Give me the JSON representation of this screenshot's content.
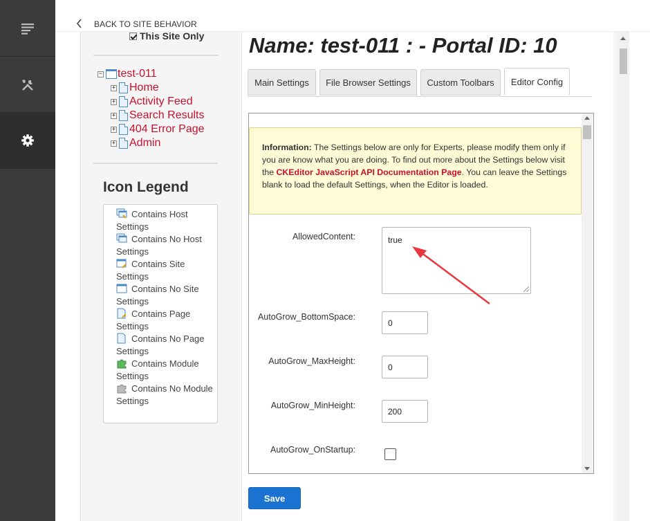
{
  "nav": {
    "back_label": "BACK TO SITE BEHAVIOR",
    "rail_icons": [
      "content-icon",
      "tools-icon",
      "settings-icon"
    ]
  },
  "tree": {
    "this_site_only_label": "This Site Only",
    "this_site_only_checked": true,
    "root": "test-011",
    "pages": [
      "Home",
      "Activity Feed",
      "Search Results",
      "404 Error Page",
      "Admin"
    ]
  },
  "legend": {
    "title": "Icon Legend",
    "items": [
      {
        "label": "Contains Host Settings",
        "icon": "host-settings-icon"
      },
      {
        "label": "Contains No Host Settings",
        "icon": "no-host-settings-icon"
      },
      {
        "label": "Contains Site Settings",
        "icon": "site-settings-icon"
      },
      {
        "label": "Contains No Site Settings",
        "icon": "no-site-settings-icon"
      },
      {
        "label": "Contains Page Settings",
        "icon": "page-settings-icon"
      },
      {
        "label": "Contains No Page Settings",
        "icon": "no-page-settings-icon"
      },
      {
        "label": "Contains Module Settings",
        "icon": "module-settings-icon"
      },
      {
        "label": "Contains No Module Settings",
        "icon": "no-module-settings-icon"
      }
    ]
  },
  "main": {
    "heading": "Name: test-011 : - Portal ID: 10",
    "tabs": [
      {
        "label": "Main Settings",
        "active": false
      },
      {
        "label": "File Browser Settings",
        "active": false
      },
      {
        "label": "Custom Toolbars",
        "active": false
      },
      {
        "label": "Editor Config",
        "active": true
      }
    ],
    "info": {
      "lead": "Information:",
      "text1": " The Settings below are only for Experts, please modify them only if you are know what you are doing. To find out more about the Settings below visit the ",
      "link": "CKEditor JavaScript API Documentation Page",
      "text2": ". You can leave the Settings blank to load the default Settings, when the Editor is loaded."
    },
    "fields": {
      "allowed_content": {
        "label": "AllowedContent:",
        "value": "true"
      },
      "bottom_space": {
        "label": "AutoGrow_BottomSpace:",
        "value": "0"
      },
      "max_height": {
        "label": "AutoGrow_MaxHeight:",
        "value": "0"
      },
      "min_height": {
        "label": "AutoGrow_MinHeight:",
        "value": "200"
      },
      "on_startup": {
        "label": "AutoGrow_OnStartup:",
        "checked": false
      }
    },
    "save_label": "Save"
  },
  "colors": {
    "accent": "#1a73d0",
    "tree_link": "#c8102e",
    "info_bg": "#fefbd6",
    "annotation_arrow": "#e8383d",
    "rail_bg": "#3b3b3b"
  }
}
